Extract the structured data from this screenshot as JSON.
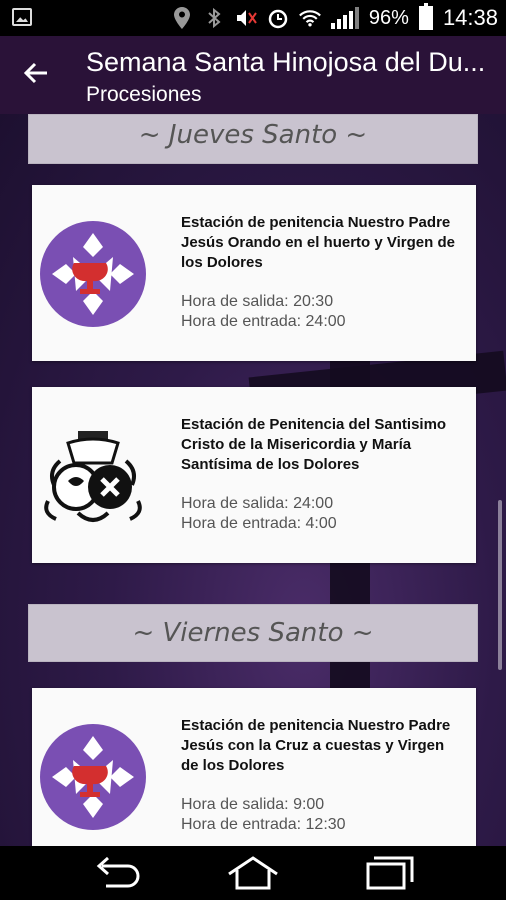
{
  "status": {
    "battery": "96%",
    "time": "14:38"
  },
  "appbar": {
    "title": "Semana Santa Hinojosa del Du...",
    "subtitle": "Procesiones"
  },
  "sections": [
    {
      "label": "~ Jueves Santo ~"
    },
    {
      "label": "~ Viernes Santo ~"
    }
  ],
  "cards": [
    {
      "title": "Estación de penitencia Nuestro Padre Jesús Orando en el huerto y Virgen de los Dolores",
      "salida": "Hora de salida: 20:30",
      "entrada": "Hora de entrada: 24:00",
      "logo": "purple-cross-chalice-emblem"
    },
    {
      "title": "Estación de Penitencia del Santisimo Cristo de la Misericordia y María Santísima de los Dolores",
      "salida": "Hora de salida: 24:00",
      "entrada": "Hora de entrada: 4:00",
      "logo": "black-white-coat-of-arms"
    },
    {
      "title": "Estación de penitencia Nuestro Padre Jesús con la Cruz a cuestas y Virgen de los Dolores",
      "salida": "Hora de salida: 9:00",
      "entrada": "Hora de entrada: 12:30",
      "logo": "purple-cross-chalice-emblem"
    }
  ],
  "colors": {
    "appbar": "#2a1238",
    "emblem_purple": "#7a4fb3",
    "chalice_red": "#d32f2f"
  }
}
